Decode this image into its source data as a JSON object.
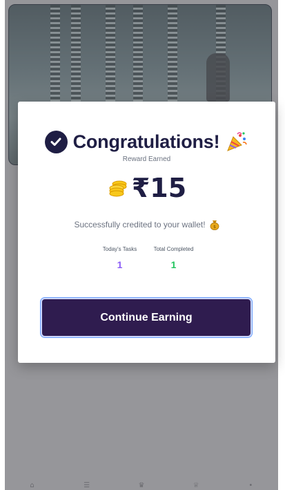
{
  "modal": {
    "title": "Congratulations!",
    "reward_label": "Reward Earned",
    "amount": "₹15",
    "credited_text": "Successfully credited to your wallet!",
    "stats": [
      {
        "label": "Today's Tasks",
        "value": "1"
      },
      {
        "label": "Total Completed",
        "value": "1"
      }
    ],
    "continue_label": "Continue Earning",
    "icons": {
      "title_left": "check-circle-icon",
      "title_right": "party-popper-icon",
      "amount": "coins-icon",
      "credited": "money-bag-icon"
    }
  },
  "colors": {
    "primary": "#1f1e44",
    "button": "#2f1c4f",
    "today_value": "#8b5cf6",
    "total_value": "#22c55e"
  },
  "bottom_nav": {
    "icons": [
      "home-icon",
      "list-icon",
      "trophy-icon",
      "crown-icon",
      "more-icon"
    ]
  }
}
